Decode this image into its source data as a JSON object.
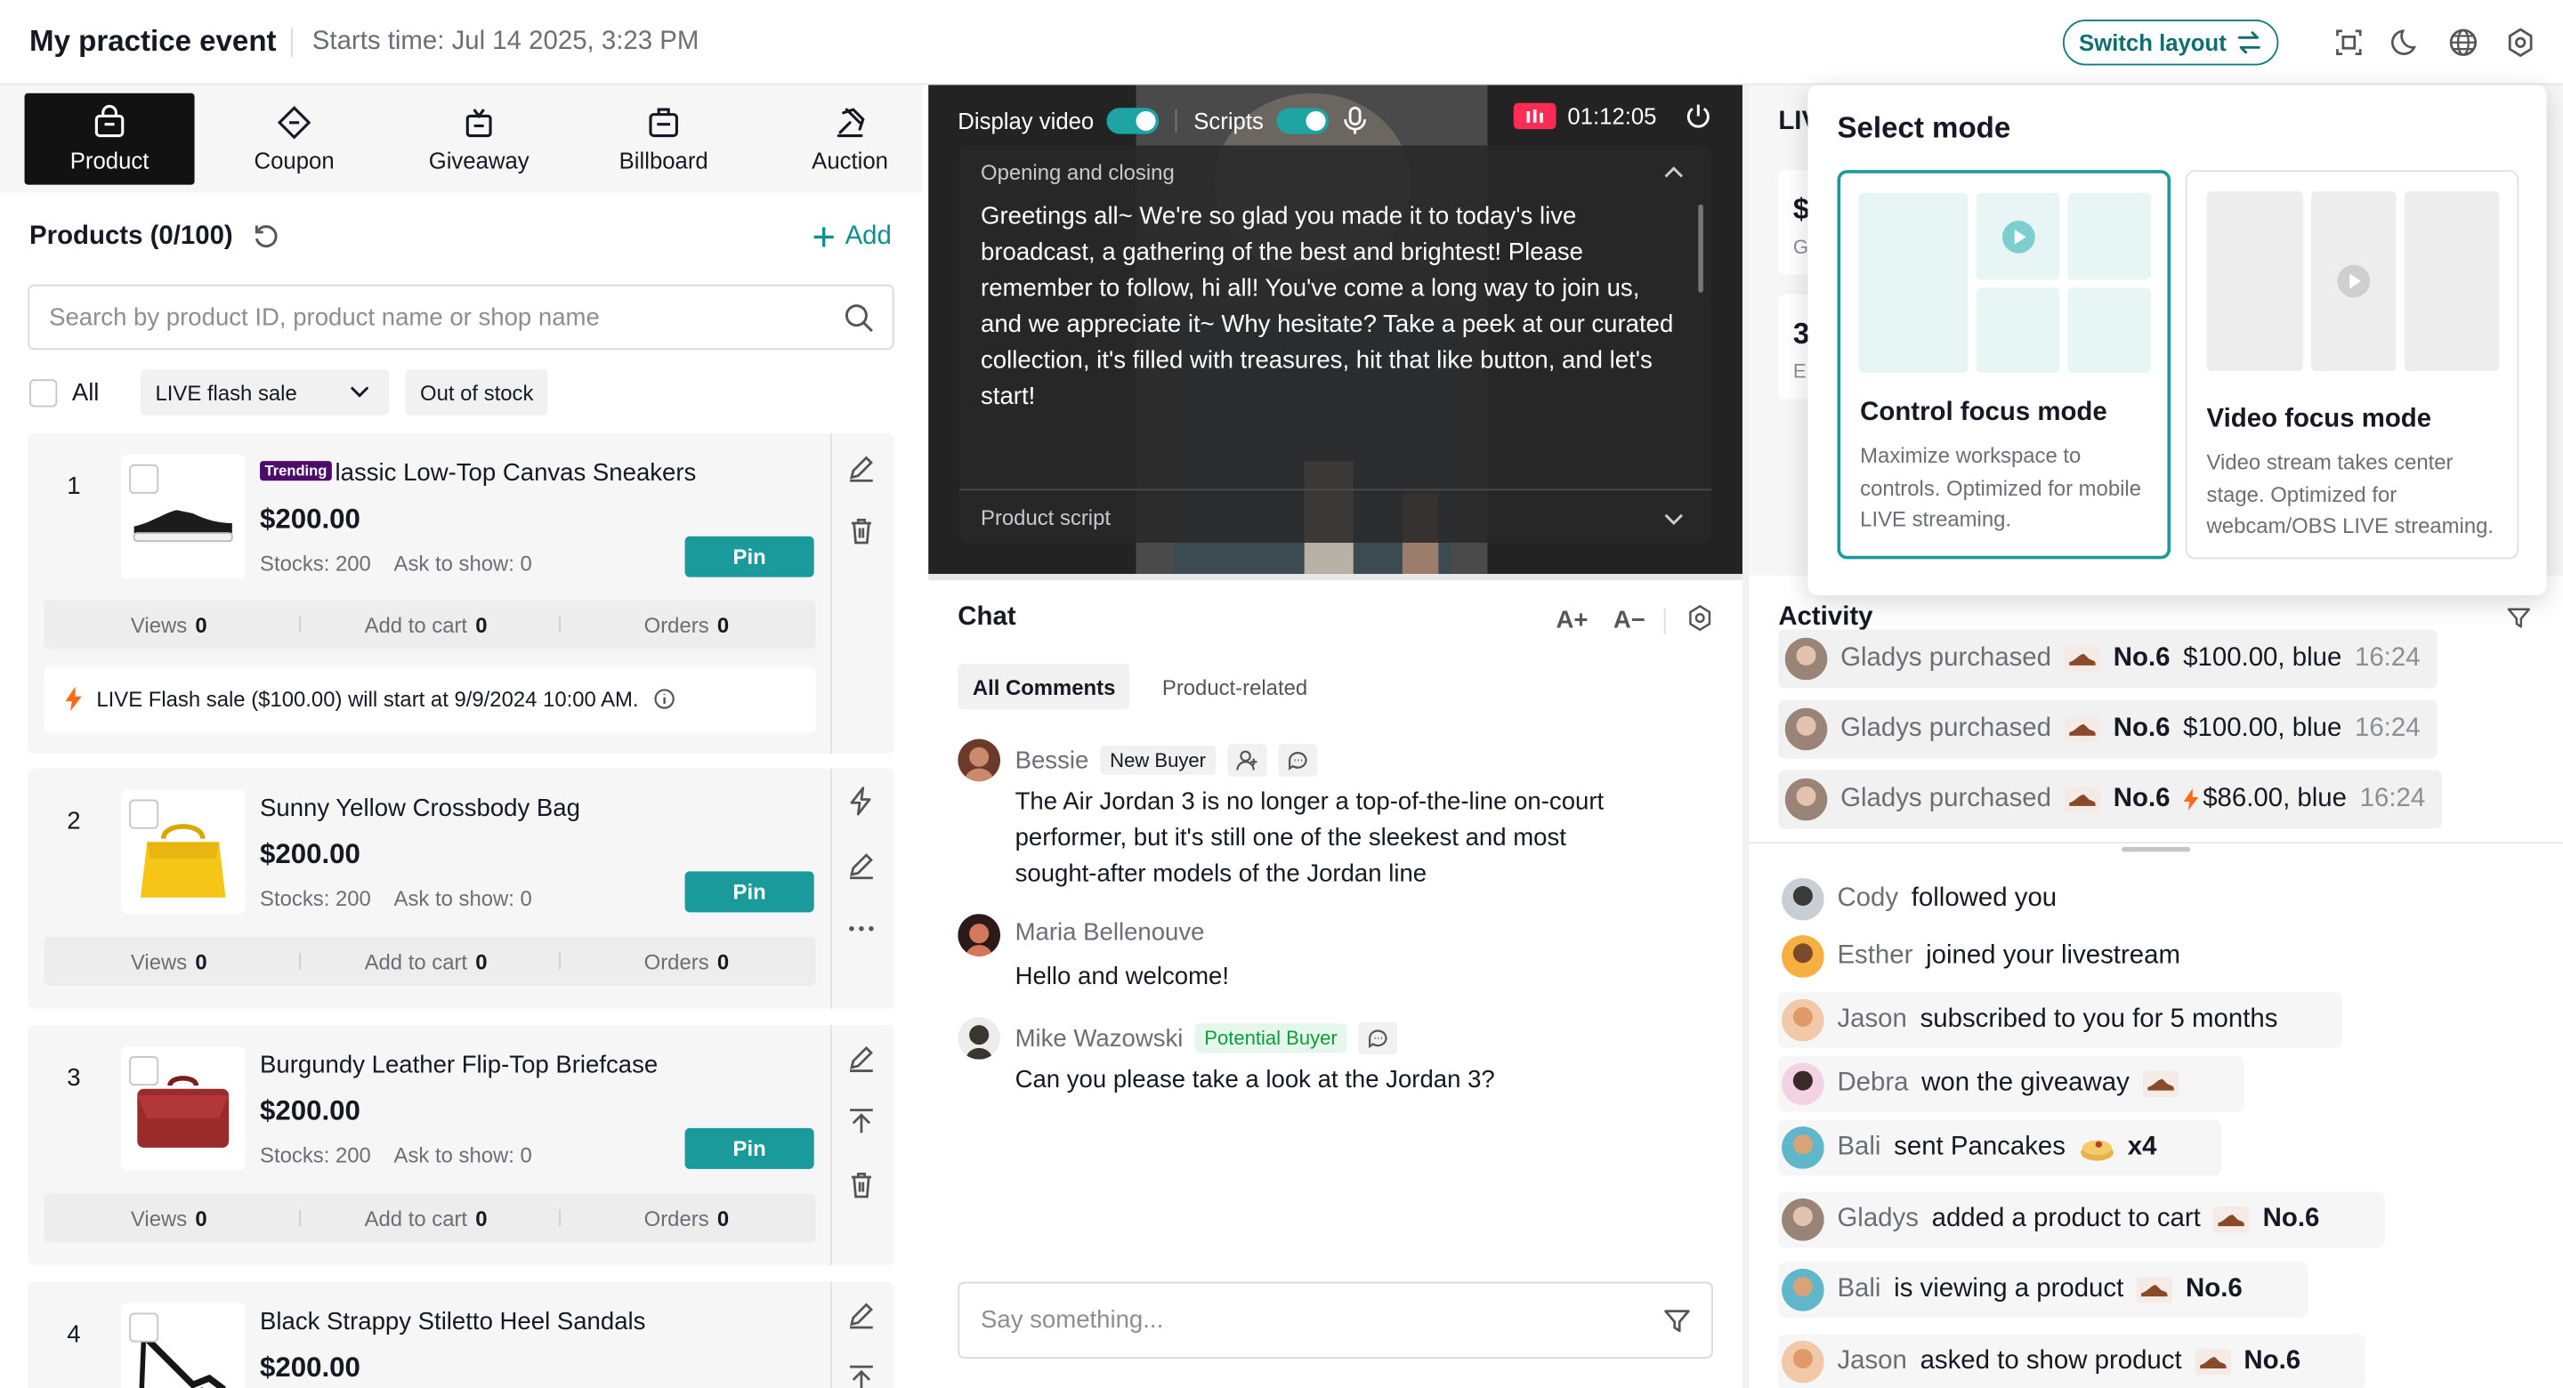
{
  "header": {
    "title": "My practice event",
    "start_time": "Starts time: Jul 14 2025, 3:23 PM",
    "switch_layout": "Switch layout"
  },
  "left_tabs": [
    {
      "label": "Product",
      "icon": "bag-icon",
      "active": true
    },
    {
      "label": "Coupon",
      "icon": "coupon-icon",
      "active": false
    },
    {
      "label": "Giveaway",
      "icon": "gift-icon",
      "active": false
    },
    {
      "label": "Billboard",
      "icon": "billboard-icon",
      "active": false
    },
    {
      "label": "Auction",
      "icon": "gavel-icon",
      "active": false
    }
  ],
  "products_panel": {
    "heading": "Products (0/100)",
    "add_label": "Add",
    "search_placeholder": "Search by product ID, product name or shop name",
    "filter_all": "All",
    "filter_dropdown": "LIVE flash sale",
    "filter_out_of_stock": "Out of stock"
  },
  "products": [
    {
      "index": "1",
      "trending": "Trending",
      "name": "Classic Low-Top Canvas Sneakers",
      "name_rest": "lassic Low-Top Canvas Sneakers",
      "price": "$200.00",
      "stocks": "Stocks: 200",
      "ask": "Ask to show: 0",
      "pin": "Pin",
      "views_label": "Views",
      "views": "0",
      "cart_label": "Add to cart",
      "cart": "0",
      "orders_label": "Orders",
      "orders": "0",
      "flash_note": "LIVE Flash sale ($100.00) will start at 9/9/2024 10:00 AM."
    },
    {
      "index": "2",
      "name": "Sunny Yellow Crossbody Bag",
      "price": "$200.00",
      "stocks": "Stocks: 200",
      "ask": "Ask to show: 0",
      "pin": "Pin",
      "views_label": "Views",
      "views": "0",
      "cart_label": "Add to cart",
      "cart": "0",
      "orders_label": "Orders",
      "orders": "0"
    },
    {
      "index": "3",
      "name": "Burgundy Leather Flip-Top Briefcase",
      "price": "$200.00",
      "stocks": "Stocks: 200",
      "ask": "Ask to show: 0",
      "pin": "Pin",
      "views_label": "Views",
      "views": "0",
      "cart_label": "Add to cart",
      "cart": "0",
      "orders_label": "Orders",
      "orders": "0"
    },
    {
      "index": "4",
      "name": "Black Strappy Stiletto Heel Sandals",
      "price": "$200.00"
    }
  ],
  "video": {
    "display_video_label": "Display video",
    "display_video_on": true,
    "scripts_label": "Scripts",
    "scripts_on": true,
    "timer": "01:12:05",
    "script_section": "Opening and closing",
    "script_text": "Greetings all~ We're so glad you made it to today's live broadcast, a gathering of the best and brightest! Please remember to follow, hi all! You've come a long way to join us, and we appreciate it~ Why hesitate? Take a peek at our curated collection, it's filled with treasures, hit that like button, and let's start!",
    "product_script": "Product script"
  },
  "chat": {
    "title": "Chat",
    "tabs": [
      "All Comments",
      "Product-related"
    ],
    "messages": [
      {
        "user": "Bessie",
        "badge": "New Buyer",
        "text": "The Air Jordan 3 is no longer a top-of-the-line on-court performer, but it's still one of the sleekest and most sought-after models of the Jordan line"
      },
      {
        "user": "Maria Bellenouve",
        "text": "Hello and welcome!"
      },
      {
        "user": "Mike Wazowski",
        "badge": "Potential Buyer",
        "text": "Can you please take a look at the Jordan 3?"
      }
    ],
    "input_placeholder": "Say something..."
  },
  "right_partial": {
    "tab_label": "LIV",
    "stat1": "$",
    "stat1_sub": "G",
    "stat2": "3",
    "stat2_sub": "E"
  },
  "activity": {
    "title": "Activity",
    "purchases": [
      {
        "text": "Gladys purchased",
        "product": "No.6",
        "detail": "$100.00, blue",
        "time": "16:24",
        "flash": false
      },
      {
        "text": "Gladys purchased",
        "product": "No.6",
        "detail": "$100.00, blue",
        "time": "16:24",
        "flash": false
      },
      {
        "text": "Gladys purchased",
        "product": "No.6",
        "detail": "$86.00, blue",
        "time": "16:24",
        "flash": true
      }
    ],
    "feed": [
      {
        "user": "Cody",
        "text": "followed you"
      },
      {
        "user": "Esther",
        "text": "joined your livestream"
      },
      {
        "user": "Jason",
        "text": "subscribed to you for 5 months"
      },
      {
        "user": "Debra",
        "text": "won the giveaway",
        "shoe": true
      },
      {
        "user": "Bali",
        "text": "sent Pancakes",
        "count": "x4"
      },
      {
        "user": "Gladys",
        "text": "added a product to cart",
        "product": "No.6"
      },
      {
        "user": "Bali",
        "text": "is viewing a product",
        "product": "No.6"
      },
      {
        "user": "Jason",
        "text": "asked to show product",
        "product": "No.6"
      }
    ]
  },
  "select_mode": {
    "title": "Select mode",
    "modes": [
      {
        "title": "Control focus mode",
        "desc": "Maximize workspace to controls. Optimized for mobile LIVE streaming.",
        "selected": true
      },
      {
        "title": "Video focus mode",
        "desc": "Video stream takes center stage. Optimized for webcam/OBS LIVE streaming.",
        "selected": false
      }
    ]
  },
  "colors": {
    "accent": "#1a9a9a",
    "live_red": "#fe2c55",
    "trending": "#4b0c6a",
    "flash": "#fe6a16"
  }
}
